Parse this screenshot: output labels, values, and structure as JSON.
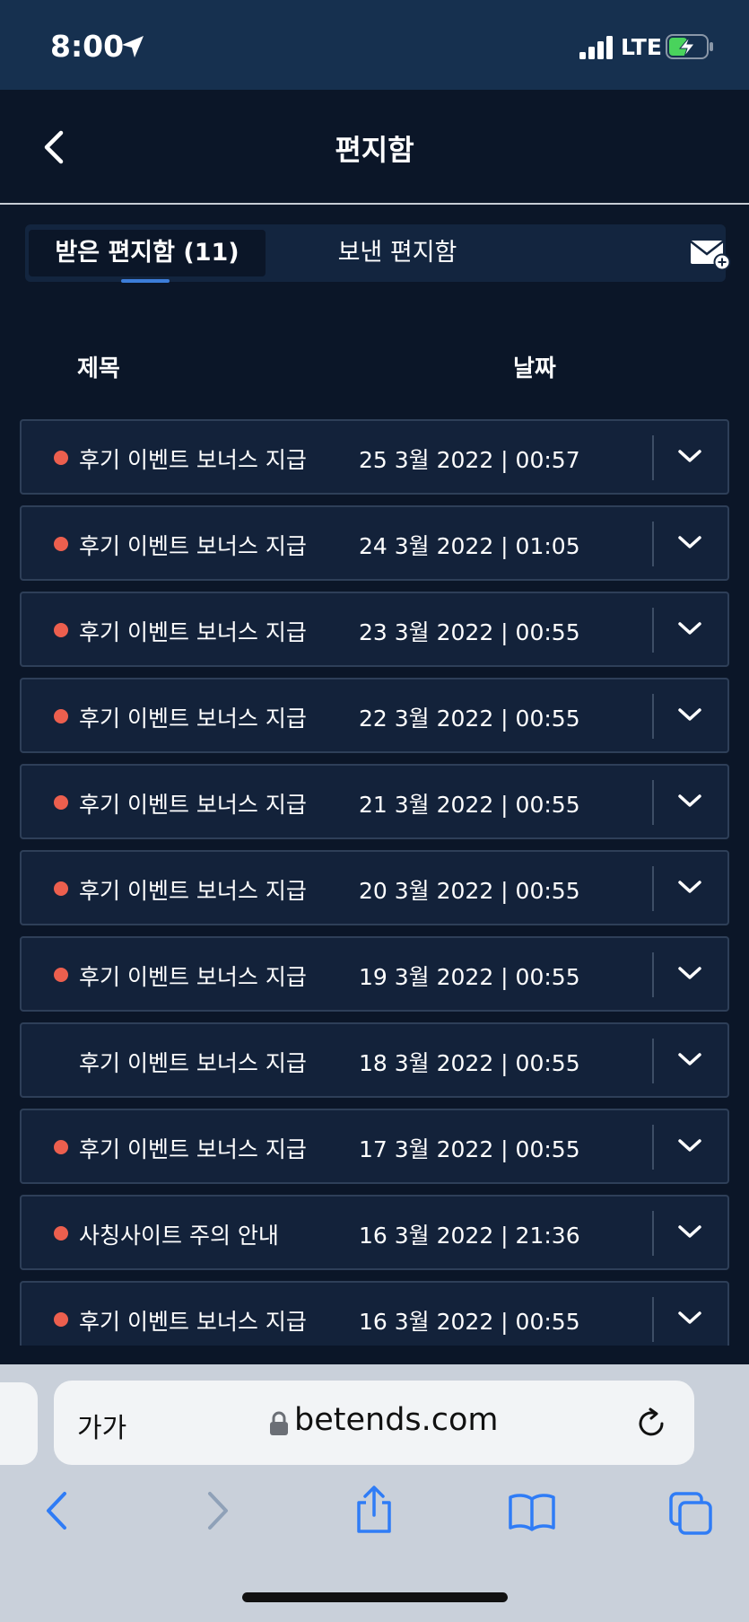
{
  "status_bar": {
    "time": "8:00",
    "network": "LTE"
  },
  "header": {
    "title": "편지함"
  },
  "tabs": {
    "inbox": "받은 편지함 (11)",
    "sent": "보낸 편지함"
  },
  "columns": {
    "subject": "제목",
    "date": "날짜"
  },
  "messages": [
    {
      "subject": "후기 이벤트 보너스 지급",
      "date": "25 3월 2022 | 00:57",
      "unread": true
    },
    {
      "subject": "후기 이벤트 보너스 지급",
      "date": "24 3월 2022 | 01:05",
      "unread": true
    },
    {
      "subject": "후기 이벤트 보너스 지급",
      "date": "23 3월 2022 | 00:55",
      "unread": true
    },
    {
      "subject": "후기 이벤트 보너스 지급",
      "date": "22 3월 2022 | 00:55",
      "unread": true
    },
    {
      "subject": "후기 이벤트 보너스 지급",
      "date": "21 3월 2022 | 00:55",
      "unread": true
    },
    {
      "subject": "후기 이벤트 보너스 지급",
      "date": "20 3월 2022 | 00:55",
      "unread": true
    },
    {
      "subject": "후기 이벤트 보너스 지급",
      "date": "19 3월 2022 | 00:55",
      "unread": true
    },
    {
      "subject": "후기 이벤트 보너스 지급",
      "date": "18 3월 2022 | 00:55",
      "unread": false
    },
    {
      "subject": "후기 이벤트 보너스 지급",
      "date": "17 3월 2022 | 00:55",
      "unread": true
    },
    {
      "subject": "사칭사이트 주의 안내",
      "date": "16 3월 2022 | 21:36",
      "unread": true
    },
    {
      "subject": "후기 이벤트 보너스 지급",
      "date": "16 3월 2022 | 00:55",
      "unread": true
    }
  ],
  "browser": {
    "text_size_label": "가가",
    "url": "betends.com"
  },
  "colors": {
    "unread_dot": "#ec5f4e",
    "accent": "#3c7dd9",
    "background": "#0b1628",
    "row_bg": "#13223a"
  }
}
